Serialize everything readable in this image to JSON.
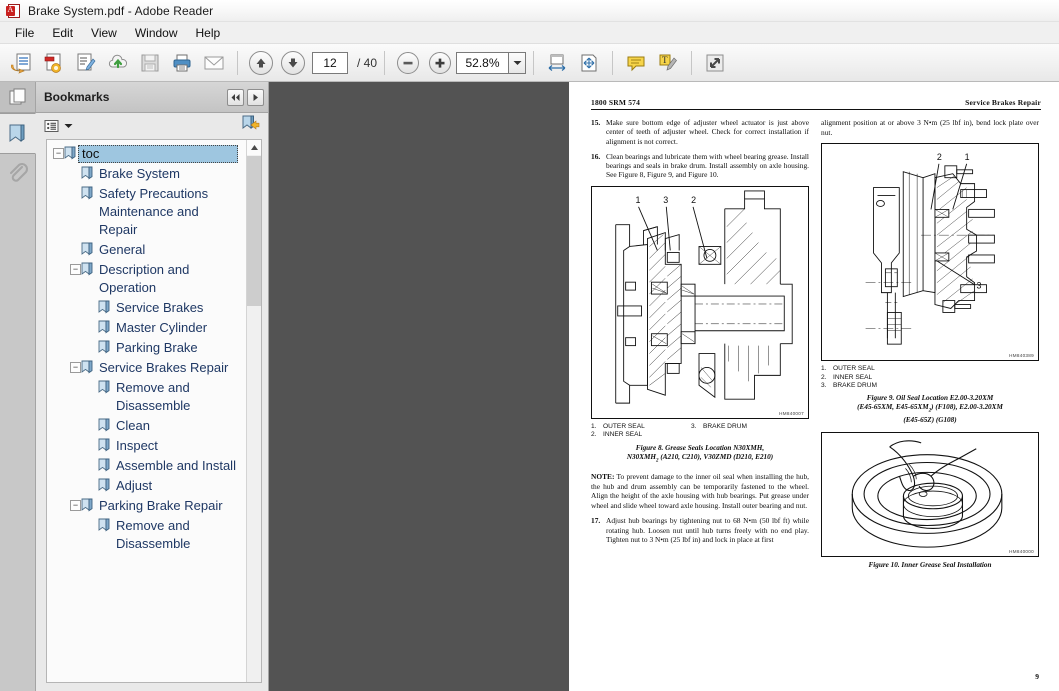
{
  "window": {
    "title": "Brake System.pdf - Adobe Reader",
    "app_icon": "adobe-reader-icon"
  },
  "menu": {
    "items": [
      {
        "label": "File"
      },
      {
        "label": "Edit"
      },
      {
        "label": "View"
      },
      {
        "label": "Window"
      },
      {
        "label": "Help"
      }
    ]
  },
  "toolbar": {
    "buttons": [
      {
        "icon": "open-file-icon",
        "name": "open-file-button"
      },
      {
        "icon": "create-pdf-icon",
        "name": "create-pdf-button"
      },
      {
        "icon": "edit-pdf-icon",
        "name": "edit-pdf-button"
      },
      {
        "icon": "upload-cloud-icon",
        "name": "upload-cloud-button"
      },
      {
        "icon": "save-icon",
        "name": "save-button"
      },
      {
        "icon": "print-icon",
        "name": "print-button"
      },
      {
        "icon": "email-icon",
        "name": "email-button"
      }
    ],
    "prev_page": "previous-page-button",
    "next_page": "next-page-button",
    "page_number": "12",
    "page_total": "/ 40",
    "zoom_out": "zoom-out-button",
    "zoom_in": "zoom-in-button",
    "zoom_value": "52.8%",
    "zoom_dropdown": "chevron-down-icon",
    "fit_width": "fit-width-button",
    "fit_page": "fit-page-button",
    "comment": "sticky-note-button",
    "highlight": "highlight-text-button",
    "fullscreen": "read-mode-button"
  },
  "rail": {
    "items": [
      {
        "name": "page-thumbnails-tab",
        "icon": "pages-icon",
        "active": false
      },
      {
        "name": "bookmarks-tab",
        "icon": "bookmark-icon",
        "active": true
      },
      {
        "name": "attachments-tab",
        "icon": "paperclip-icon",
        "active": false
      }
    ]
  },
  "bookmarks_panel": {
    "title": "Bookmarks",
    "collapse_button": "collapse-panel-button",
    "expand_button": "expand-panel-button",
    "options_button": "bookmark-options-button",
    "new_bookmark_button": "new-bookmark-button",
    "tree": [
      {
        "label": "toc",
        "level": 0,
        "expander": "minus",
        "selected": true
      },
      {
        "label": "Brake System",
        "level": 1,
        "expander": "none",
        "selected": false
      },
      {
        "label": "Safety Precautions Maintenance and Repair",
        "level": 1,
        "expander": "none",
        "selected": false
      },
      {
        "label": "General",
        "level": 1,
        "expander": "none",
        "selected": false
      },
      {
        "label": "Description and Operation",
        "level": 1,
        "expander": "minus",
        "selected": false
      },
      {
        "label": "Service Brakes",
        "level": 2,
        "expander": "none",
        "selected": false
      },
      {
        "label": "Master Cylinder",
        "level": 2,
        "expander": "none",
        "selected": false
      },
      {
        "label": "Parking Brake",
        "level": 2,
        "expander": "none",
        "selected": false
      },
      {
        "label": "Service Brakes Repair",
        "level": 1,
        "expander": "minus",
        "selected": false
      },
      {
        "label": "Remove and Disassemble",
        "level": 2,
        "expander": "none",
        "selected": false
      },
      {
        "label": "Clean",
        "level": 2,
        "expander": "none",
        "selected": false
      },
      {
        "label": "Inspect",
        "level": 2,
        "expander": "none",
        "selected": false
      },
      {
        "label": "Assemble and Install",
        "level": 2,
        "expander": "none",
        "selected": false
      },
      {
        "label": "Adjust",
        "level": 2,
        "expander": "none",
        "selected": false
      },
      {
        "label": "Parking Brake Repair",
        "level": 1,
        "expander": "minus",
        "selected": false
      },
      {
        "label": "Remove and Disassemble",
        "level": 2,
        "expander": "none",
        "selected": false
      }
    ]
  },
  "document": {
    "header_left": "1800 SRM 574",
    "header_right": "Service Brakes Repair",
    "page_number": "9",
    "left_column": {
      "step15_num": "15.",
      "step15_text": "Make sure bottom edge of adjuster wheel actuator is just above center of teeth of adjuster wheel. Check for correct installation if alignment is not correct.",
      "step16_num": "16.",
      "step16_text": "Clean bearings and lubricate them with wheel bearing grease. Install bearings and seals in brake drum. Install assembly on axle housing. See Figure 8, Figure 9, and Figure 10.",
      "figure8": {
        "id": "HM840007",
        "legend": [
          {
            "num": "1.",
            "label": "OUTER SEAL"
          },
          {
            "num": "2.",
            "label": "INNER SEAL"
          },
          {
            "num": "3.",
            "label": "BRAKE DRUM"
          }
        ],
        "caption_line1": "Figure 8.  Grease Seals Location N30XMH,",
        "caption_line2": "N30XMH",
        "caption_line2_sub": "2",
        "caption_line2_rest": " (A210, C210), V30ZMD (D210, E210)"
      },
      "note_label": "NOTE:",
      "note_text": " To prevent damage to the inner oil seal when installing the hub, the hub and drum assembly can be temporarily fastened to the wheel.  Align the height of the axle housing with hub bearings.  Put grease under wheel and slide wheel toward axle housing. Install outer bearing and nut.",
      "step17_num": "17.",
      "step17_text": "Adjust hub bearings by tightening nut to 68 N•m (50 lbf ft) while rotating hub.  Loosen nut until hub turns freely with no end play.  Tighten nut to 3 N•m (25 lbf in) and lock in place at first"
    },
    "right_column": {
      "continuation_text": "alignment position at or above 3 N•m (25 lbf in), bend lock plate over nut.",
      "figure9": {
        "id": "HM840389",
        "legend": [
          {
            "num": "1.",
            "label": "OUTER SEAL"
          },
          {
            "num": "2.",
            "label": "INNER SEAL"
          },
          {
            "num": "3.",
            "label": "BRAKE DRUM"
          }
        ],
        "caption_line1": "Figure 9.  Oil Seal Location E2.00-3.20XM",
        "caption_line2_a": "(E45-65XM, E45-65XM",
        "caption_line2_sub": "2",
        "caption_line2_b": ") (F108), E2.00-3.20XM",
        "caption_line3": "(E45-65Z) (G108)"
      },
      "figure10": {
        "id": "HM840000",
        "caption": "Figure 10.  Inner Grease Seal Installation"
      }
    }
  },
  "colors": {
    "bookmark_text": "#1f3864",
    "selection": "#9ec6e0",
    "viewer_background": "#535353",
    "chrome": "#f0f0f0"
  }
}
